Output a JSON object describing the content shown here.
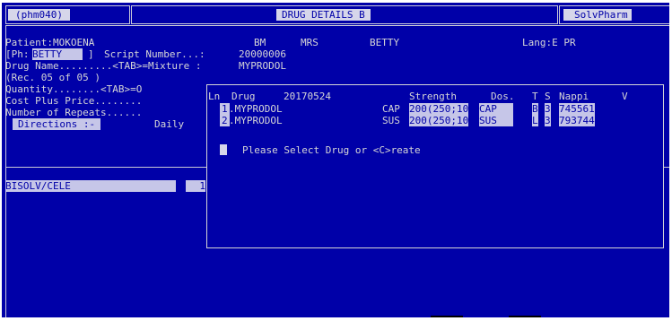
{
  "header": {
    "program_id": "(phm040)",
    "title": "DRUG DETAILS",
    "title_cursor": "B",
    "app_name": "SolvPharm"
  },
  "patient": {
    "label": "Patient:MOKOENA",
    "initials": "BM",
    "title": "MRS",
    "first_name": "BETTY",
    "lang": "Lang:E PR"
  },
  "ph_row": {
    "prefix": "[Ph:",
    "value": "BETTY",
    "suffix": "]",
    "script_label": "Script Number...:",
    "script_value": "20000006"
  },
  "drug_row": {
    "label": "Drug Name.........<TAB>=Mixture :",
    "value": "MYPRODOL"
  },
  "record": "(Rec. 05 of 05 )",
  "quantity": "Quantity........<TAB>=O",
  "cost_plus": "Cost Plus Price........",
  "repeats": "Number of Repeats......",
  "directions": {
    "label": "Directions :-",
    "value": "Daily"
  },
  "bottom": {
    "field_value": "BISOLV/CELE",
    "field_value2": "1"
  },
  "popup": {
    "columns": {
      "ln": "Ln",
      "drug": "Drug",
      "date": "20170524",
      "strength": "Strength",
      "dos": "Dos.",
      "t": "T",
      "s": "S",
      "nappi": "Nappi",
      "v": "V"
    },
    "rows": [
      {
        "ln": "1",
        "name": ".MYPRODOL",
        "form": "CAP",
        "strength": "200(250;10",
        "dos": "CAP",
        "t": "B",
        "s": "3",
        "nappi": "745561"
      },
      {
        "ln": "2",
        "name": ".MYPRODOL",
        "form": "SUS",
        "strength": "200(250;10",
        "dos": "SUS",
        "t": "L",
        "s": "3",
        "nappi": "793744"
      }
    ],
    "prompt": "Please Select Drug or <C>reate"
  }
}
